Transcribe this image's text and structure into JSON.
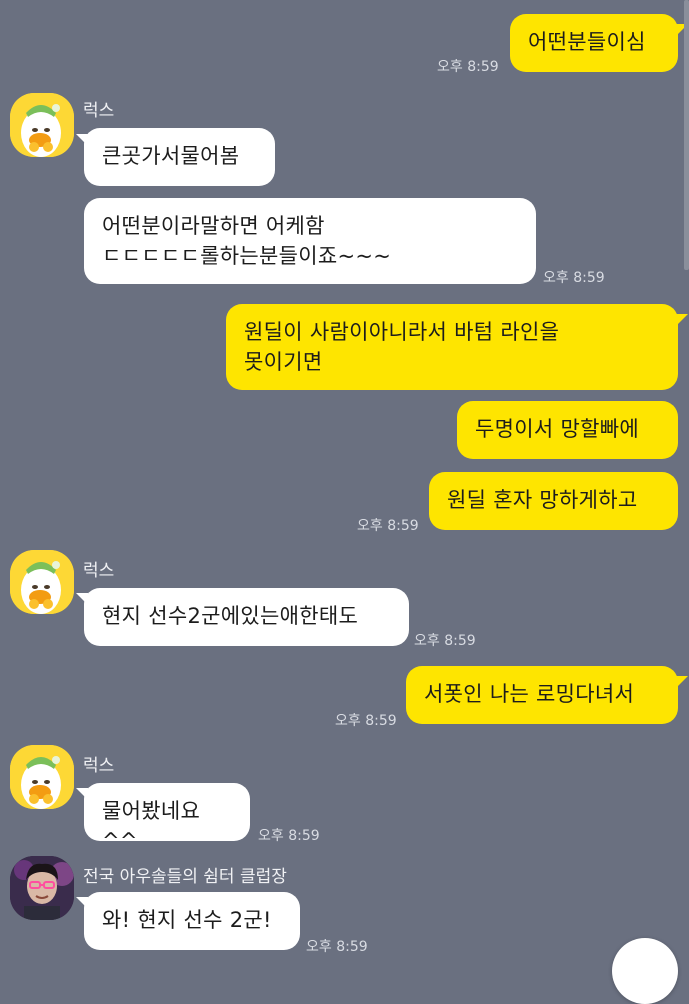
{
  "messages": [
    {
      "text": "어떤분들이심",
      "time": "오후 8:59"
    },
    {
      "sender": "럭스",
      "text": "큰곳가서물어봄"
    },
    {
      "text": "어떤분이라말하면 어케함\nㄷㄷㄷㄷㄷ롤하는분들이죠~~~",
      "time": "오후 8:59"
    },
    {
      "text": "원딜이 사람이아니라서 바텀 라인을\n못이기면"
    },
    {
      "text": "두명이서 망할빠에"
    },
    {
      "text": "원딜 혼자 망하게하고",
      "time": "오후 8:59"
    },
    {
      "sender": "럭스",
      "text": "현지 선수2군에있는애한태도",
      "time": "오후 8:59"
    },
    {
      "text": "서폿인 나는 로밍다녀서",
      "time": "오후 8:59"
    },
    {
      "sender": "럭스",
      "text": "물어봤네요^^",
      "time": "오후 8:59"
    },
    {
      "sender": "전국 아우솔들의 쉼터 클럽장",
      "text": "와! 현지 선수 2군!",
      "time": "오후 8:59"
    }
  ],
  "colors": {
    "background": "#6a7080",
    "my_bubble": "#fee500",
    "other_bubble": "#ffffff"
  }
}
